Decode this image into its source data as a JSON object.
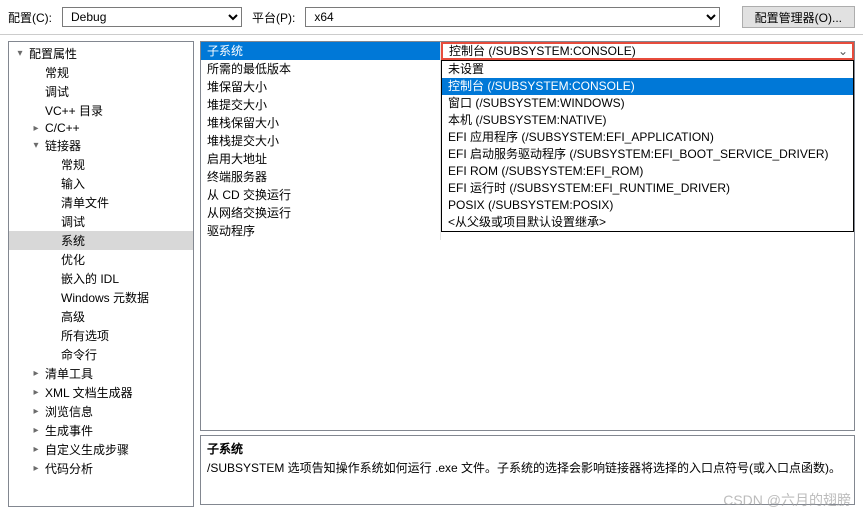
{
  "topBar": {
    "configLabel": "配置(C):",
    "configValue": "Debug",
    "platformLabel": "平台(P):",
    "platformValue": "x64",
    "managerBtn": "配置管理器(O)..."
  },
  "tree": [
    {
      "label": "配置属性",
      "indent": 0,
      "toggle": "▾"
    },
    {
      "label": "常规",
      "indent": 1,
      "toggle": ""
    },
    {
      "label": "调试",
      "indent": 1,
      "toggle": ""
    },
    {
      "label": "VC++ 目录",
      "indent": 1,
      "toggle": ""
    },
    {
      "label": "C/C++",
      "indent": 1,
      "toggle": "▸"
    },
    {
      "label": "链接器",
      "indent": 1,
      "toggle": "▾"
    },
    {
      "label": "常规",
      "indent": 2,
      "toggle": ""
    },
    {
      "label": "输入",
      "indent": 2,
      "toggle": ""
    },
    {
      "label": "清单文件",
      "indent": 2,
      "toggle": ""
    },
    {
      "label": "调试",
      "indent": 2,
      "toggle": ""
    },
    {
      "label": "系统",
      "indent": 2,
      "toggle": "",
      "selected": true
    },
    {
      "label": "优化",
      "indent": 2,
      "toggle": ""
    },
    {
      "label": "嵌入的 IDL",
      "indent": 2,
      "toggle": ""
    },
    {
      "label": "Windows 元数据",
      "indent": 2,
      "toggle": ""
    },
    {
      "label": "高级",
      "indent": 2,
      "toggle": ""
    },
    {
      "label": "所有选项",
      "indent": 2,
      "toggle": ""
    },
    {
      "label": "命令行",
      "indent": 2,
      "toggle": ""
    },
    {
      "label": "清单工具",
      "indent": 1,
      "toggle": "▸"
    },
    {
      "label": "XML 文档生成器",
      "indent": 1,
      "toggle": "▸"
    },
    {
      "label": "浏览信息",
      "indent": 1,
      "toggle": "▸"
    },
    {
      "label": "生成事件",
      "indent": 1,
      "toggle": "▸"
    },
    {
      "label": "自定义生成步骤",
      "indent": 1,
      "toggle": "▸"
    },
    {
      "label": "代码分析",
      "indent": 1,
      "toggle": "▸"
    }
  ],
  "grid": {
    "headerLeft": "子系统",
    "headerRight": "控制台 (/SUBSYSTEM:CONSOLE)",
    "rows": [
      {
        "name": "所需的最低版本",
        "value": ""
      },
      {
        "name": "堆保留大小",
        "value": ""
      },
      {
        "name": "堆提交大小",
        "value": ""
      },
      {
        "name": "堆栈保留大小",
        "value": ""
      },
      {
        "name": "堆栈提交大小",
        "value": ""
      },
      {
        "name": "启用大地址",
        "value": ""
      },
      {
        "name": "终端服务器",
        "value": ""
      },
      {
        "name": "从 CD 交换运行",
        "value": ""
      },
      {
        "name": "从网络交换运行",
        "value": ""
      },
      {
        "name": "驱动程序",
        "value": ""
      }
    ]
  },
  "dropdown": [
    {
      "label": "未设置"
    },
    {
      "label": "控制台 (/SUBSYSTEM:CONSOLE)",
      "selected": true
    },
    {
      "label": "窗口 (/SUBSYSTEM:WINDOWS)"
    },
    {
      "label": "本机 (/SUBSYSTEM:NATIVE)"
    },
    {
      "label": "EFI 应用程序 (/SUBSYSTEM:EFI_APPLICATION)"
    },
    {
      "label": "EFI 启动服务驱动程序 (/SUBSYSTEM:EFI_BOOT_SERVICE_DRIVER)"
    },
    {
      "label": "EFI ROM (/SUBSYSTEM:EFI_ROM)"
    },
    {
      "label": "EFI 运行时 (/SUBSYSTEM:EFI_RUNTIME_DRIVER)"
    },
    {
      "label": "POSIX (/SUBSYSTEM:POSIX)"
    },
    {
      "label": "<从父级或项目默认设置继承>"
    }
  ],
  "description": {
    "title": "子系统",
    "text": "/SUBSYSTEM 选项告知操作系统如何运行 .exe 文件。子系统的选择会影响链接器将选择的入口点符号(或入口点函数)。"
  },
  "watermark": "CSDN @六月的翅膀"
}
